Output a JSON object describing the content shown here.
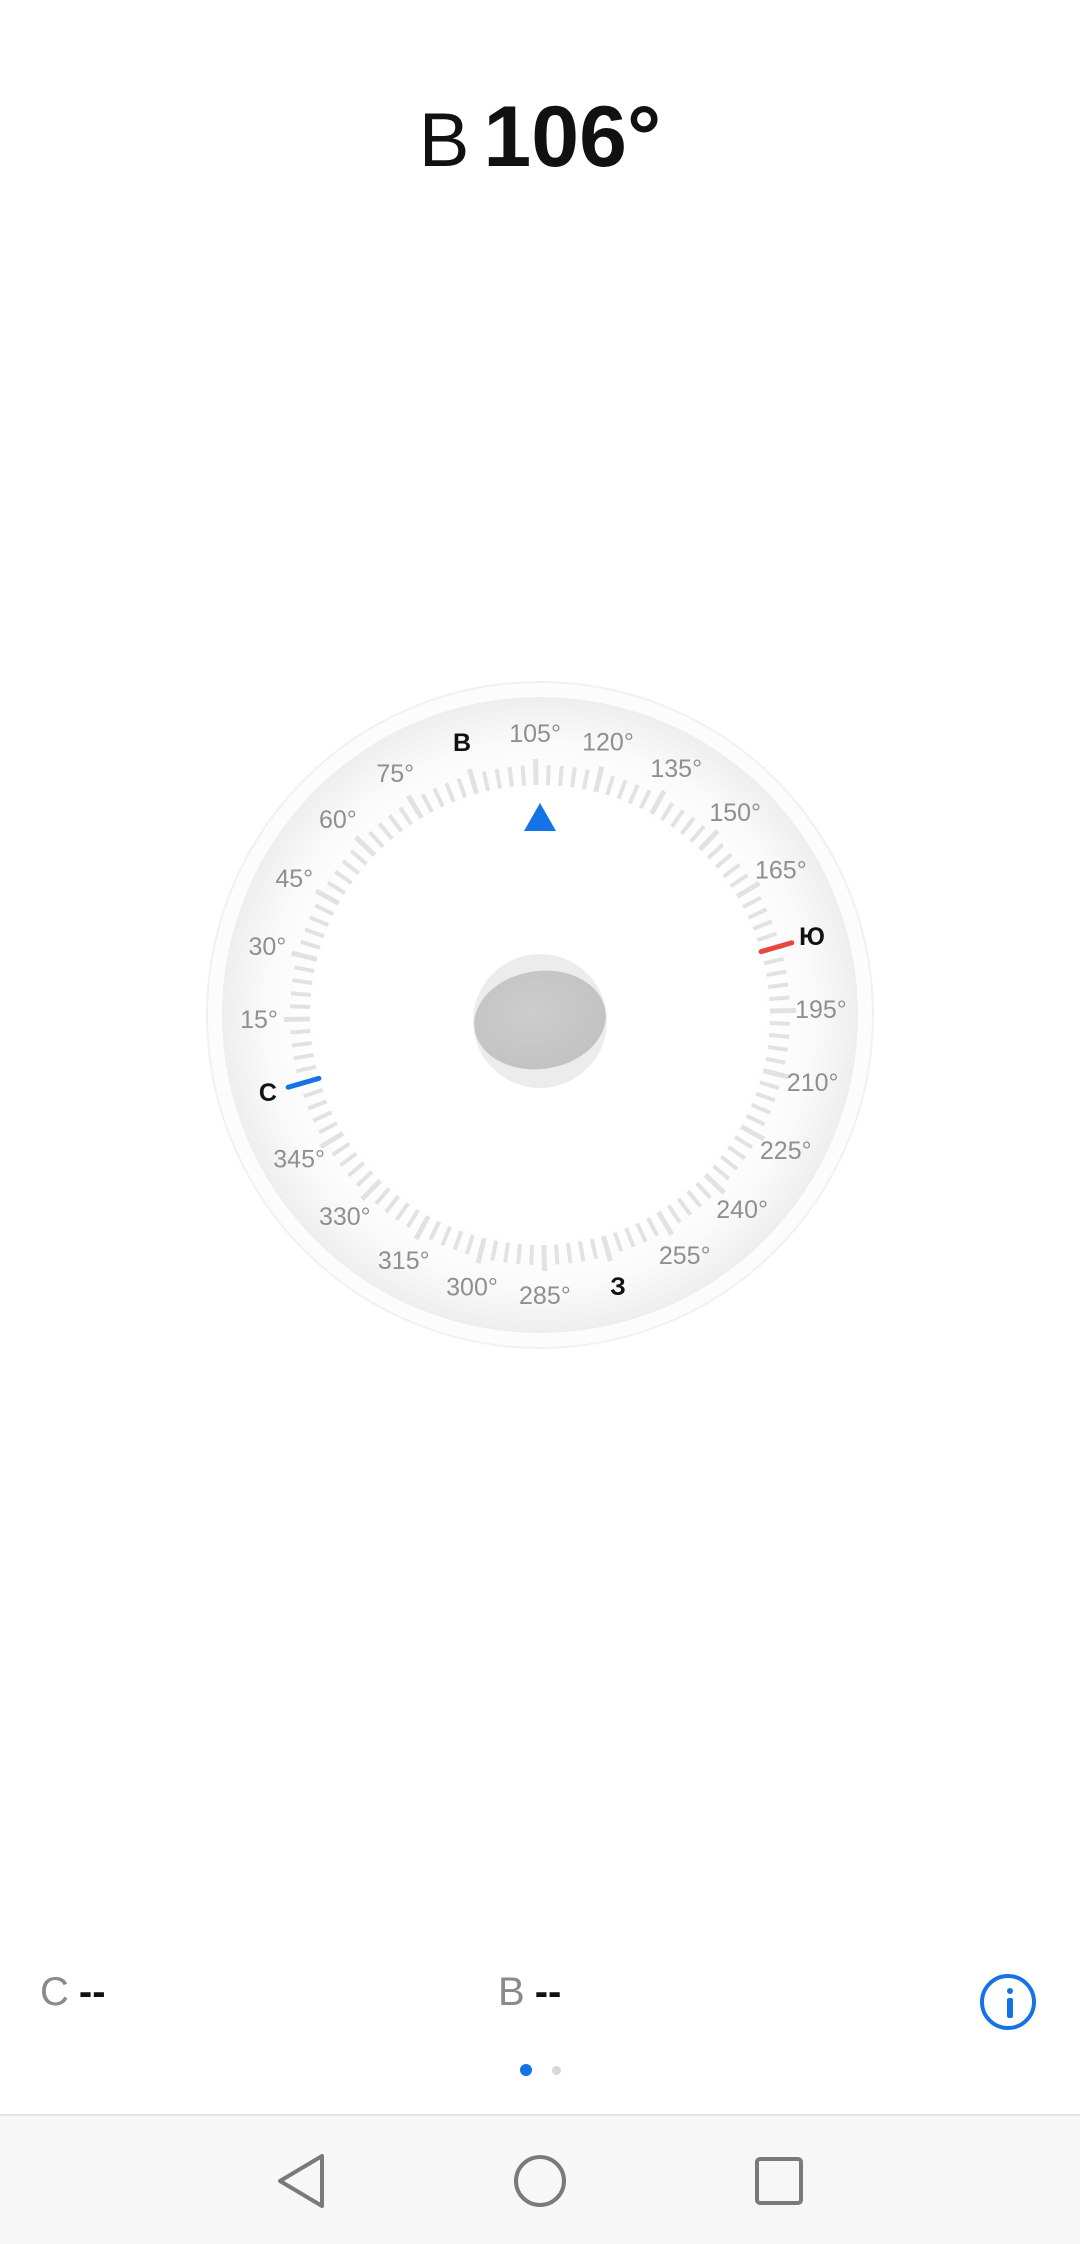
{
  "header": {
    "direction": "В",
    "heading": "106°"
  },
  "compass": {
    "heading_value": 106,
    "cardinals": [
      {
        "label": "С",
        "bearing": 0
      },
      {
        "label": "В",
        "bearing": 90
      },
      {
        "label": "Ю",
        "bearing": 180
      },
      {
        "label": "З",
        "bearing": 270
      }
    ],
    "degree_labels": [
      "15°",
      "30°",
      "45°",
      "60°",
      "75°",
      "105°",
      "120°",
      "135°",
      "150°",
      "165°",
      "195°",
      "210°",
      "225°",
      "240°",
      "255°",
      "285°",
      "300°",
      "315°",
      "330°",
      "345°"
    ],
    "colors": {
      "pointer": "#1473e6",
      "north_needle": "#1473e6",
      "south_needle": "#e8473f",
      "ticks": "#e2e2e2",
      "degree_label": "#8f8f8f",
      "cardinal_label": "#111111"
    },
    "icons": {
      "pointer": "triangle-pointer-icon",
      "level": "bubble-level-icon"
    }
  },
  "readouts": {
    "latitude_prefix": "С",
    "latitude_value": "--",
    "longitude_prefix": "В",
    "longitude_value": "--"
  },
  "info_icon": "info-icon",
  "pager": {
    "page_count": 2,
    "active_page": 1,
    "active_color": "#1473e6",
    "inactive_color": "#d8d8d8"
  },
  "navbar": {
    "icons": [
      "back-icon",
      "home-icon",
      "recents-icon"
    ]
  }
}
